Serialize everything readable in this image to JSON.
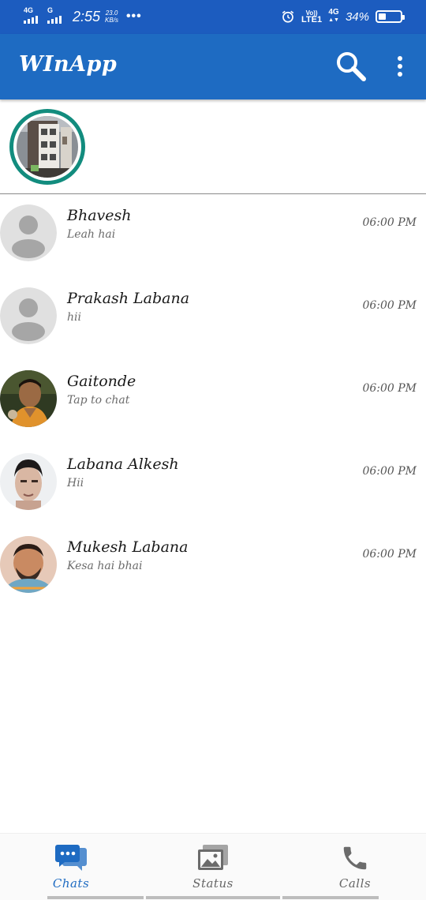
{
  "status_bar": {
    "sim1_network": "4G",
    "sim2_network": "G",
    "time": "2:55",
    "speed_value": "23.0",
    "speed_unit": "KB/s",
    "overflow": "•••",
    "volte_top": "Vo))",
    "volte_bottom": "LTE1",
    "data_network": "4G",
    "battery_percent": "34%",
    "battery_level": 0.34,
    "icons": [
      "signal-icon",
      "alarm-icon",
      "battery-icon"
    ]
  },
  "app_bar": {
    "title": "WInApp",
    "icons": [
      "search-icon",
      "more-vert-icon"
    ]
  },
  "colors": {
    "status_bar": "#1c5cbf",
    "app_bar": "#1e6bc2",
    "status_ring": "#128c7e",
    "active_tab": "#1e6bc2",
    "inactive_tab": "#666666"
  },
  "chats": [
    {
      "name": "Bhavesh",
      "message": "Leah hai",
      "time": "06:00 PM",
      "avatar": "default-avatar-icon"
    },
    {
      "name": "Prakash Labana",
      "message": "hii",
      "time": "06:00 PM",
      "avatar": "default-avatar-icon"
    },
    {
      "name": "Gaitonde",
      "message": "Tap to chat",
      "time": "06:00 PM",
      "avatar": "photo"
    },
    {
      "name": "Labana Alkesh",
      "message": "Hii",
      "time": "06:00 PM",
      "avatar": "photo"
    },
    {
      "name": "Mukesh Labana",
      "message": "Kesa hai bhai",
      "time": "06:00 PM",
      "avatar": "photo"
    }
  ],
  "bottom_nav": {
    "tabs": [
      {
        "label": "Chats",
        "icon": "chat-icon",
        "active": true
      },
      {
        "label": "Status",
        "icon": "image-icon",
        "active": false
      },
      {
        "label": "Calls",
        "icon": "phone-icon",
        "active": false
      }
    ]
  }
}
